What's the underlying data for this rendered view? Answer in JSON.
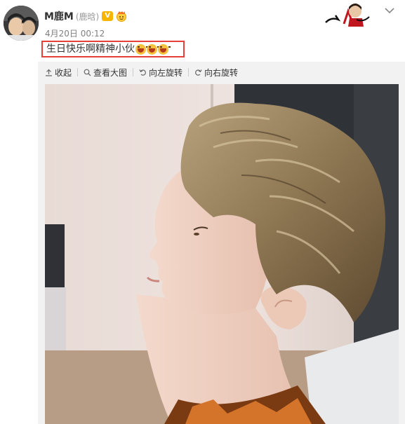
{
  "post": {
    "username": "M鹿M",
    "remark": "(鹿晗)",
    "verified_badge": "V",
    "timestamp": "4月20日 00:12",
    "text": "生日快乐啊精神小伙",
    "emoji_count": 3,
    "emoji_icon": "laughing-emoji-icon",
    "highlight_color": "#e5403a"
  },
  "toolbar": {
    "collapse_label": "收起",
    "view_large_label": "查看大图",
    "rotate_left_label": "向左旋转",
    "rotate_right_label": "向右旋转"
  },
  "colors": {
    "badge": "#f7b500",
    "panel_bg": "#f2f2f2",
    "text": "#333333",
    "muted": "#808080"
  }
}
